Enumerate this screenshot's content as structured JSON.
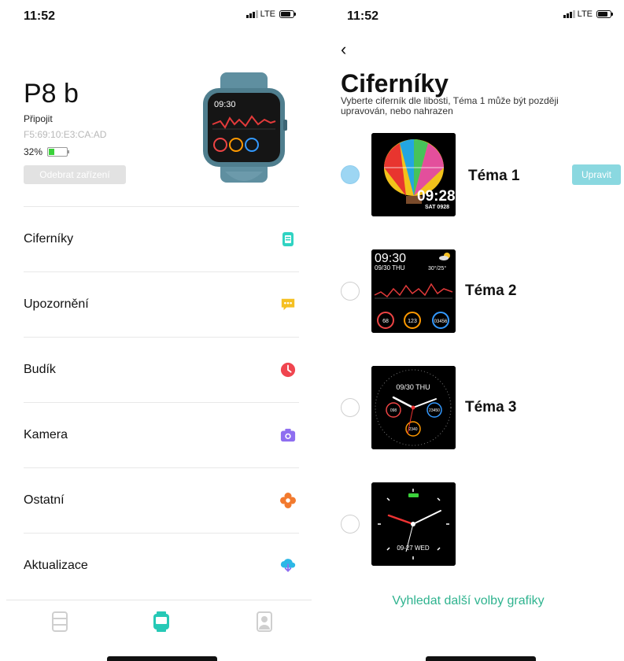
{
  "left": {
    "status": {
      "time": "11:52",
      "network": "LTE"
    },
    "device": {
      "name": "P8 b",
      "status": "Připojit",
      "mac": "F5:69:10:E3:CA:AD",
      "battery": "32%",
      "battery_level": 0.32,
      "remove_label": "Odebrat zařízení",
      "watch_time": "09:30"
    },
    "menu": [
      {
        "label": "Ciferníky",
        "icon": "watchface-icon",
        "color": "#2fd3c2"
      },
      {
        "label": "Upozornění",
        "icon": "message-icon",
        "color": "#f5c022"
      },
      {
        "label": "Budík",
        "icon": "clock-icon",
        "color": "#f0454f"
      },
      {
        "label": "Kamera",
        "icon": "camera-icon",
        "color": "#8e6ef0"
      },
      {
        "label": "Ostatní",
        "icon": "flower-icon",
        "color": "#f27a2e"
      },
      {
        "label": "Aktualizace",
        "icon": "cloud-download-icon",
        "color": "#2cb7e6"
      }
    ],
    "tabs": [
      {
        "icon": "device-list-icon",
        "active": false
      },
      {
        "icon": "watch-icon",
        "active": true
      },
      {
        "icon": "profile-icon",
        "active": false
      }
    ]
  },
  "right": {
    "status": {
      "time": "11:52",
      "network": "LTE"
    },
    "title": "Ciferníky",
    "subtitle": "Vyberte ciferník dle libosti, Téma 1 může být později upravován, nebo nahrazen",
    "themes": [
      {
        "name": "Téma 1",
        "selected": true,
        "thumb_time": "09:28",
        "thumb_date": "SAT 0928"
      },
      {
        "name": "Téma 2",
        "selected": false,
        "thumb_time": "09:30",
        "thumb_day": "09/30 THU",
        "thumb_temp": "30°/25°",
        "stats": [
          "68",
          "123",
          "03456"
        ]
      },
      {
        "name": "Téma 3",
        "selected": false,
        "thumb_day": "09/30 THU",
        "stats": [
          "098",
          "23450",
          "2340"
        ]
      },
      {
        "name": "",
        "selected": false,
        "thumb_day": "09-27 WED"
      }
    ],
    "edit_label": "Upravit",
    "more_label": "Vyhledat další volby grafiky"
  }
}
